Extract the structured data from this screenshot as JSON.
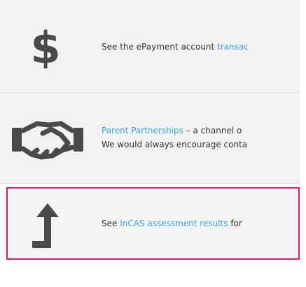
{
  "items": [
    {
      "icon": "dollar-icon",
      "text_before": "See the ePayment account ",
      "link": "transac",
      "text_after": ""
    },
    {
      "icon": "handshake-icon",
      "link": "Parent Partnerships",
      "text_after": " – a channel o",
      "line2": "We would always encourage conta"
    },
    {
      "icon": "arrow-up-icon",
      "text_before": "See ",
      "link": "InCAS assessment results",
      "text_after": " for"
    }
  ],
  "colors": {
    "row_bg": "#f2f2f2",
    "icon": "#4a4a4a",
    "link": "#3aa3d4",
    "highlight_border": "#e0176f"
  }
}
